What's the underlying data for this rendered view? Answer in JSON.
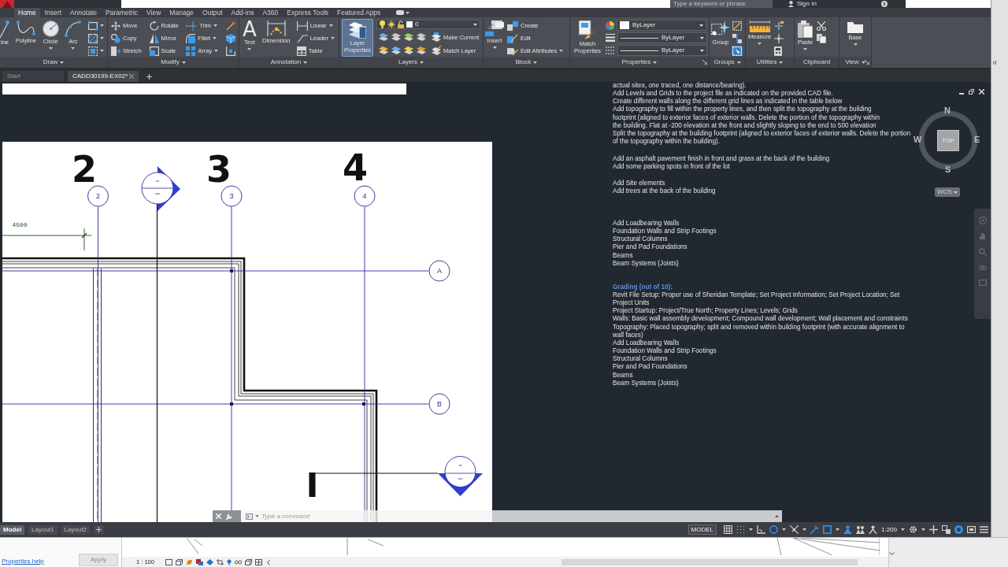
{
  "title_bar": {
    "search": {
      "placeholder": "Type a keyword or phrase"
    },
    "sign_in": "Sign In"
  },
  "ribbon_tabs": [
    {
      "label": "Home",
      "selected": true
    },
    {
      "label": "Insert",
      "selected": false
    },
    {
      "label": "Annotate",
      "selected": false
    },
    {
      "label": "Parametric",
      "selected": false
    },
    {
      "label": "View",
      "selected": false
    },
    {
      "label": "Manage",
      "selected": false
    },
    {
      "label": "Output",
      "selected": false
    },
    {
      "label": "Add-ins",
      "selected": false
    },
    {
      "label": "A360",
      "selected": false
    },
    {
      "label": "Express Tools",
      "selected": false
    },
    {
      "label": "Featured Apps",
      "selected": false
    }
  ],
  "ribbon_panels": [
    {
      "title": "Draw",
      "title_menu": true,
      "launcher": false,
      "columns": [
        {
          "kind": "large",
          "tools": [
            {
              "label": "ine",
              "dropdown": false,
              "highlighted": false
            }
          ]
        },
        {
          "kind": "large",
          "tools": [
            {
              "label": "Polyline",
              "dropdown": false,
              "highlighted": false
            }
          ]
        },
        {
          "kind": "large",
          "tools": [
            {
              "label": "Circle",
              "dropdown": true,
              "highlighted": false
            }
          ]
        },
        {
          "kind": "large",
          "tools": [
            {
              "label": "Arc",
              "dropdown": true,
              "highlighted": false
            }
          ]
        },
        {
          "kind": "stack",
          "tools": [
            {
              "dropdown": true
            },
            {
              "dropdown": true
            },
            {
              "dropdown": true
            }
          ]
        }
      ]
    },
    {
      "title": "Modify",
      "title_menu": true,
      "launcher": false,
      "columns": [
        {
          "kind": "stack",
          "tools": [
            {
              "label": "Move",
              "dropdown": false
            },
            {
              "label": "Copy",
              "dropdown": false
            },
            {
              "label": "Stretch",
              "dropdown": false
            }
          ]
        },
        {
          "kind": "stack",
          "tools": [
            {
              "label": "Rotate",
              "dropdown": false
            },
            {
              "label": "Mirror",
              "dropdown": false
            },
            {
              "label": "Scale",
              "dropdown": false
            }
          ]
        },
        {
          "kind": "stack",
          "tools": [
            {
              "label": "Trim",
              "dropdown": true
            },
            {
              "label": "Fillet",
              "dropdown": true
            },
            {
              "label": "Array",
              "dropdown": true
            }
          ]
        },
        {
          "kind": "stack",
          "tools": [
            {
              "dropdown": false
            },
            {
              "dropdown": false
            },
            {
              "dropdown": false
            }
          ]
        }
      ]
    },
    {
      "title": "Annotation",
      "title_menu": true,
      "launcher": false,
      "columns": [
        {
          "kind": "large",
          "tools": [
            {
              "glyph": "A",
              "label": "Text",
              "dropdown": true,
              "highlighted": false
            }
          ]
        },
        {
          "kind": "large",
          "tools": [
            {
              "label": "Dimension",
              "dropdown": false,
              "highlighted": false
            }
          ]
        },
        {
          "kind": "stack",
          "tools": [
            {
              "label": "Linear",
              "dropdown": true
            },
            {
              "label": "Leader",
              "dropdown": true
            },
            {
              "label": "Table",
              "dropdown": false
            }
          ]
        }
      ]
    },
    {
      "title": "Layers",
      "title_menu": true,
      "launcher": false,
      "columns": [
        {
          "kind": "large",
          "tools": [
            {
              "label": "Layer Properties",
              "dropdown": false,
              "highlighted": true
            }
          ]
        },
        {
          "kind": "layer_controls",
          "current_layer": "0",
          "tools": [
            {
              "label": "Make Current"
            },
            {
              "label": "Match Layer"
            }
          ]
        }
      ]
    },
    {
      "title": "Block",
      "title_menu": true,
      "launcher": false,
      "columns": [
        {
          "kind": "large",
          "tools": [
            {
              "label": "Insert",
              "dropdown": true,
              "highlighted": false
            }
          ]
        },
        {
          "kind": "stack",
          "tools": [
            {
              "label": "Create",
              "dropdown": false
            },
            {
              "label": "Edit",
              "dropdown": false
            },
            {
              "label": "Edit Attributes",
              "dropdown": true
            }
          ]
        }
      ]
    },
    {
      "title": "Properties",
      "title_menu": true,
      "launcher": true,
      "columns": [
        {
          "kind": "large",
          "tools": [
            {
              "label": "Match Properties",
              "dropdown": false,
              "highlighted": false
            }
          ]
        },
        {
          "kind": "property_controls",
          "controls": [
            {
              "kind": "color",
              "value": "ByLayer"
            },
            {
              "kind": "lineweight",
              "value": "ByLayer"
            },
            {
              "kind": "linetype",
              "value": "ByLayer"
            }
          ]
        }
      ]
    },
    {
      "title": "Groups",
      "title_menu": true,
      "launcher": false,
      "columns": [
        {
          "kind": "large",
          "tools": [
            {
              "label": "Group",
              "dropdown": false,
              "highlighted": false
            }
          ]
        },
        {
          "kind": "stack",
          "tools": [
            {
              "dropdown": false,
              "on": false
            },
            {
              "dropdown": false,
              "on": false
            },
            {
              "dropdown": false,
              "on": true
            }
          ]
        }
      ]
    },
    {
      "title": "Utilities",
      "title_menu": true,
      "launcher": false,
      "columns": [
        {
          "kind": "large",
          "tools": [
            {
              "label": "Measure",
              "dropdown": true,
              "highlighted": false
            }
          ]
        },
        {
          "kind": "stack",
          "tools": [
            {
              "dropdown": false
            },
            {
              "dropdown": false
            },
            {
              "dropdown": false
            }
          ]
        }
      ]
    },
    {
      "title": "Clipboard",
      "title_menu": false,
      "launcher": false,
      "columns": [
        {
          "kind": "large",
          "tools": [
            {
              "label": "Paste",
              "dropdown": true,
              "highlighted": false
            }
          ]
        },
        {
          "kind": "stack",
          "tools": [
            {
              "dropdown": false
            },
            {
              "dropdown": false
            }
          ]
        }
      ]
    },
    {
      "title": "View",
      "title_menu": true,
      "launcher": true,
      "columns": [
        {
          "kind": "large",
          "tools": [
            {
              "label": "Base",
              "dropdown": true,
              "highlighted": false
            }
          ]
        }
      ]
    }
  ],
  "file_tabs": [
    {
      "label": "Start",
      "selected": false,
      "closable": false
    },
    {
      "label": "CADD30199-EX02*",
      "selected": true,
      "closable": true
    }
  ],
  "notes": [
    {
      "paragraphs": [
        [
          "actual sites, one traced, one distance/bearing)."
        ],
        [
          "Add Levels and Grids to the project file as indicated on the provided CAD file."
        ],
        [
          "Create different walls along the different grid lines as indicated in the table below"
        ],
        [
          "Add topography to fill within the property lines, and then split the topography at the building",
          "footprint (aligned to exterior faces of exterior walls. Delete the portion of the topography within",
          "the building. Flat at -200 elevation at the front and slightly sloping to the end to 500 elevation"
        ],
        [
          "Split the topography at the building footprint (aligned to exterior faces of exterior walls. Delete the portion",
          "of the topography within the building)."
        ]
      ]
    },
    {
      "paragraphs": [
        [
          "Add an asphalt pavement finish in front and grass at the back of the building"
        ],
        [
          "Add some parking spots in front of the lot"
        ]
      ]
    },
    {
      "paragraphs": [
        [
          "Add Site elements"
        ],
        [
          "Add trees at the back of the building"
        ]
      ]
    },
    {
      "paragraphs": [
        [
          "Add Loadbearing Walls"
        ],
        [
          "Foundation Walls and Strip Footings"
        ],
        [
          "Structural Columns"
        ],
        [
          "Pier and Pad Foundations"
        ],
        [
          "Beams"
        ],
        [
          "Beam Systems (Joists)"
        ]
      ]
    },
    {
      "heading": "Grading (out of 10):",
      "paragraphs": [
        [
          "Revit File Setup: Proper use of Sheridan Template; Set Project Information; Set Project Location; Set",
          "Project Units"
        ],
        [
          "Project Startup: Project/True North; Property Lines; Levels; Grids"
        ],
        [
          "Walls: Basic wall assembly development; Compound wall development; Wall placement and constraints"
        ],
        [
          "Topography: Placed topography; split and removed within building footprint (with accurate alignment to",
          "wall faces)"
        ],
        [
          "Add Loadbearing Walls"
        ],
        [
          "Foundation Walls and Strip Footings"
        ],
        [
          "Structural Columns"
        ],
        [
          "Pier and Pad Foundations"
        ],
        [
          "Beams"
        ],
        [
          "Beam Systems (Joists)"
        ]
      ]
    }
  ],
  "sheet": {
    "handwritten_labels": [
      "2",
      "3",
      "4"
    ],
    "grid_bubbles": [
      "2",
      "3",
      "4",
      "A",
      "B"
    ],
    "dimension": "4500"
  },
  "view_cube": {
    "face": "TOP",
    "north": "N",
    "east": "E",
    "south": "S",
    "west": "W",
    "ucs": "WCS"
  },
  "command_line": {
    "placeholder": "Type a command"
  },
  "layout_tabs": [
    {
      "label": "Model",
      "selected": true
    },
    {
      "label": "Layout1",
      "selected": false
    },
    {
      "label": "Layout2",
      "selected": false
    }
  ],
  "status_bar": {
    "space": "MODEL",
    "scale": "1:200",
    "toggles": [
      {
        "on": false
      },
      {
        "on": false
      },
      {
        "on": false
      },
      {
        "on": true
      },
      {
        "on": false
      },
      {
        "on": true
      },
      {
        "on": true
      },
      {
        "on": true
      },
      {
        "on": false
      },
      {
        "on": false
      },
      {
        "on": false
      },
      {
        "on": false
      },
      {
        "on": false
      },
      {
        "on": true
      },
      {
        "on": false
      },
      {
        "on": false
      }
    ]
  },
  "background_window": {
    "help_link": "Properties help",
    "apply_button": {
      "label": "Apply",
      "disabled": true
    },
    "view_scale": "1 : 100"
  },
  "edge_fragment": "ri"
}
